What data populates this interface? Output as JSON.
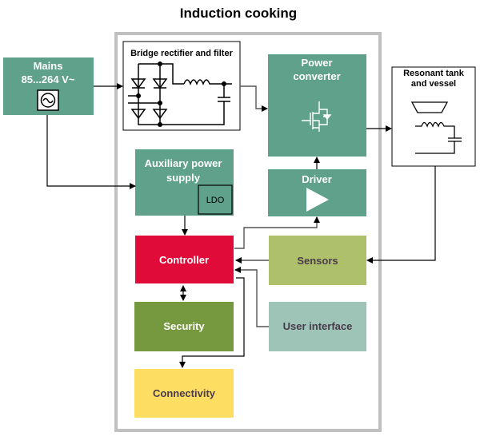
{
  "title": "Induction cooking",
  "blocks": {
    "mains": {
      "line1": "Mains",
      "line2": "85...264 V~",
      "icon": "ac-source-icon"
    },
    "bridge": {
      "label": "Bridge rectifier and filter"
    },
    "power_converter": {
      "line1": "Power",
      "line2": "converter",
      "icon": "mosfet-icon"
    },
    "resonant_tank": {
      "line1": "Resonant tank",
      "line2": "and vessel"
    },
    "aux_power": {
      "line1": "Auxiliary power",
      "line2": "supply",
      "ldo": "LDO"
    },
    "driver": {
      "label": "Driver",
      "icon": "amplifier-triangle-icon"
    },
    "controller": {
      "label": "Controller"
    },
    "sensors": {
      "label": "Sensors"
    },
    "security": {
      "label": "Security"
    },
    "user_interface": {
      "label": "User interface"
    },
    "connectivity": {
      "label": "Connectivity"
    }
  },
  "colors": {
    "teal": "#5fa18b",
    "controller": "#e00b38",
    "sensors": "#afc06c",
    "security": "#76993f",
    "user_interface": "#9dc4b7",
    "connectivity": "#fede62",
    "frame": "#c0c0c0"
  }
}
